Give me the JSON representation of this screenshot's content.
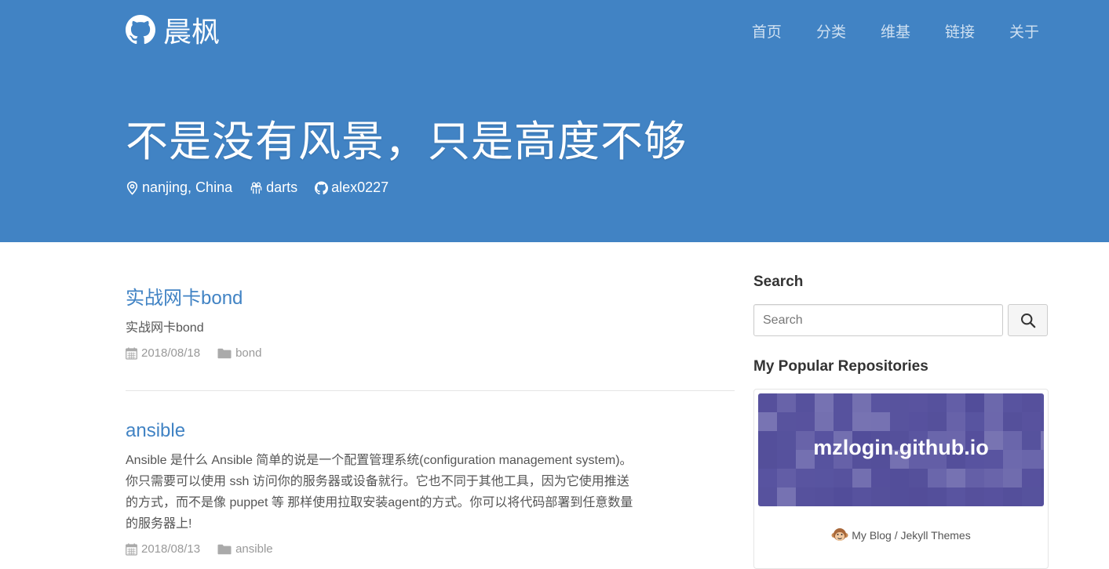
{
  "site": {
    "brand": "晨枫",
    "nav": [
      "首页",
      "分类",
      "维基",
      "链接",
      "关于"
    ]
  },
  "hero": {
    "title": "不是没有风景，只是高度不够",
    "location": "nanjing, China",
    "org": "darts",
    "github": "alex0227"
  },
  "posts": [
    {
      "title": "实战网卡bond",
      "excerpt": "实战网卡bond",
      "date": "2018/08/18",
      "category": "bond"
    },
    {
      "title": "ansible",
      "excerpt": "Ansible 是什么 Ansible 简单的说是一个配置管理系统(configuration management system)。你只需要可以使用 ssh 访问你的服务器或设备就行。它也不同于其他工具，因为它使用推送的方式，而不是像 puppet 等 那样使用拉取安装agent的方式。你可以将代码部署到任意数量的服务器上!",
      "date": "2018/08/13",
      "category": "ansible"
    }
  ],
  "sidebar": {
    "search_heading": "Search",
    "search_placeholder": "Search",
    "repos_heading": "My Popular Repositories",
    "repo": {
      "name": "mzlogin.github.io",
      "description": "My Blog / Jekyll Themes"
    }
  },
  "colors": {
    "header_bg": "#4183c4",
    "link": "#4183c4",
    "repo_banner": "#5c57a3"
  },
  "icons": {
    "brand": "github-icon",
    "location": "map-marker-icon",
    "org": "organization-icon",
    "github": "github-icon",
    "date": "calendar-icon",
    "category": "folder-icon",
    "search": "search-icon",
    "repo_emoji": "monkey-icon"
  }
}
